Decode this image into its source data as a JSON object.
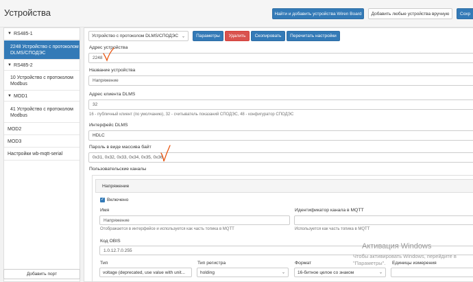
{
  "header": {
    "title": "Устройства",
    "find_add_button": "Найти и добавить устройства Wiren Board",
    "add_manual_button": "Добавить любые устройства вручную",
    "save_button_partial": "Сохр"
  },
  "sidebar": {
    "items": [
      {
        "label": "RS485-1",
        "group": true
      },
      {
        "label": "2248 Устройство с протоколом DLMS/СПОДЭС",
        "active": true
      },
      {
        "label": "RS485-2",
        "group": true
      },
      {
        "label": "10 Устройство с протоколом Modbus"
      },
      {
        "label": "MOD1",
        "group": true
      },
      {
        "label": "41 Устройство с протоколом Modbus"
      },
      {
        "label": "MOD2"
      },
      {
        "label": "MOD3"
      },
      {
        "label": "Настройки wb-mqtt-serial"
      }
    ],
    "add_port": "Добавить порт"
  },
  "toolbar": {
    "device_type": "Устройство с протоколом DLMS/СПОДЭС",
    "params_button": "Параметры",
    "delete_button": "Удалить",
    "copy_button": "Скопировать",
    "reread_button": "Перечитать настройки"
  },
  "form": {
    "address_label": "Адрес устройства",
    "address_value": "2248",
    "name_label": "Название устройства",
    "name_value": "Напряжение",
    "client_label": "Адрес клиента DLMS",
    "client_value": "32",
    "client_help": "16 - публичный клиент (по умолчанию), 32 - считыватель показаний СПОДЭС, 48 - конфигуратор СПОДЭС",
    "iface_label": "Интерфейс DLMS",
    "iface_value": "HDLC",
    "password_label": "Пароль в виде массива байт",
    "password_value": "0x31, 0x32, 0x33, 0x34, 0x35, 0x36",
    "channels_label": "Пользовательские каналы"
  },
  "channel": {
    "header": "Напряжение",
    "enabled_label": "Включено",
    "name_label": "Имя",
    "name_value": "Напряжение",
    "name_help": "Отображается в интерфейсе и используется как часть топика в MQTT",
    "mqtt_id_label": "Идентификатор канала в MQTT",
    "mqtt_id_help": "Используется как часть топика в MQTT",
    "obis_label": "Код OBIS",
    "obis_value": "1.0.12.7.0.255",
    "type_label": "Тип",
    "type_value": "voltage (deprecated, use value with unit...",
    "reg_type_label": "Тип регистра",
    "reg_type_value": "holding",
    "format_label": "Формат",
    "format_value": "16-битное целое со знаком",
    "units_label": "Единицы измерения"
  },
  "watermark": {
    "line1": "Активация Windows",
    "line2": "Чтобы активировать Windows, перейдите в",
    "line3": "\"Параметры\"."
  },
  "colors": {
    "primary": "#337ab7",
    "danger": "#d9534f",
    "annotation": "#e8540f"
  }
}
